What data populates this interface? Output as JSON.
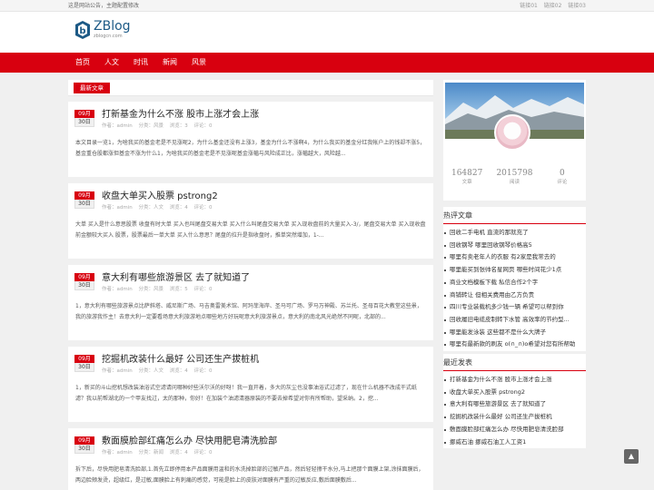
{
  "topbar": {
    "notice": "这是网站公告，主题配置修改",
    "links": [
      "链接01",
      "链接02",
      "链接03"
    ]
  },
  "logo": {
    "name": "ZBlog",
    "sub": "zblogcn.com"
  },
  "nav": [
    "首页",
    "人文",
    "时讯",
    "新闻",
    "风景"
  ],
  "section": {
    "title": "最新文章"
  },
  "posts": [
    {
      "month": "09月",
      "day": "30日",
      "title": "打新基金为什么不涨 股市上涨才会上涨",
      "author": "作者：admin",
      "category": "分类：风景",
      "views": "浏览：3",
      "comments": "评论：0",
      "excerpt": "本文目录一览1，为啥我买的基金老是不见涨呢2，为什么基金还没有上涨3，基金为什么不涨啊4，为什么我买的基金分红我帐户上的钱却不涨5，基金重仓股都涨但基金不涨为什么1，为啥我买的基金老是不见涨呢基金涨幅与风险成正比，涨幅越大，风险越..."
    },
    {
      "month": "09月",
      "day": "30日",
      "title": "收盘大单买入股票 pstrong2",
      "author": "作者：admin",
      "category": "分类：人文",
      "views": "浏览：4",
      "comments": "评论：0",
      "excerpt": "大单 买入是什么意思股票 收盘有时大单 买入也叫尾盘交易大单 买入什么叫尾盘交易大单 买入现收盘前的大量买入-3/，尾盘交易大单 买入现收盘前金额较大买入 股票，股票最后一单大单 买入什么意思？尾盘的拉升是指收盘时，推单突然增加，1-..."
    },
    {
      "month": "09月",
      "day": "30日",
      "title": "意大利有哪些旅游景区 去了就知道了",
      "author": "作者：admin",
      "category": "分类：风景",
      "views": "浏览：5",
      "comments": "评论：0",
      "excerpt": "1，意大利有哪些旅游景点比萨斜塔、威尼斯广场、马吉奥雷美术馆、阿玛菲海岸、圣马可广场、罗马万神殿、苏兰托、圣母百花大教堂这些景，我的旅游我作主！去意大利一定要看场意大利旅游地点哪些地方好玩呢意大利旅游景点，意大利的南北风光绝然不同呢，北部的..."
    },
    {
      "month": "09月",
      "day": "30日",
      "title": "挖掘机改装什么最好 公司还生产拔桩机",
      "author": "作者：admin",
      "category": "分类：人文",
      "views": "浏览：4",
      "comments": "评论：0",
      "excerpt": "1，新买的斗山挖机想改装油浴式空滤请问哪种好些沃尔沃的好呀！我一直开着，多大的灰尘也没事油浴式过滤了，现在什么机器不改成干式纸滤？我以前帮湖北的一个甲友找过，太的那种，你好！在加装个油滤清器原装的不要去掉希望对你有所帮助，望采纳。2，挖..."
    },
    {
      "month": "09月",
      "day": "30日",
      "title": "敷面膜脸部红痛怎么办 尽快用肥皂清洗脸部",
      "author": "作者：admin",
      "category": "分类：新闻",
      "views": "浏览：4",
      "comments": "评论：0",
      "excerpt": "拆下后，尽快用肥皂清洗脸部,1.首先立即停用本产品面膜用温和的水洗掉脸部的过敏产品，然后轻轻擦干水分,马上把那个面膜上架,涂抹面膜后，两边脸颊发烫，超级红，是过敏,面膜脸上有刺痛的感觉，可能是脸上的皮肤对面膜有严重的过敏反应,敷后面膜敷后..."
    }
  ],
  "profile": {
    "stats": [
      {
        "num": "164827",
        "label": "文章"
      },
      {
        "num": "2015798",
        "label": "阅读"
      },
      {
        "num": "0",
        "label": "评论"
      }
    ]
  },
  "hot": {
    "title": "热评文章",
    "items": [
      "回收二手电机 直流的那就充了",
      "回收钢琴 哪里回收钢琴价格高5",
      "哪里有卖老年人的衣服 有2家是我常去的",
      "哪里能买到张帅名星网页 哪些时间花少1点",
      "商业文档模板下载 私信合作2个字",
      "商铺转让 但相关费用由乙方负责",
      "四川专业装载机多少钱一辆 希望可以帮到你",
      "回收履旧电缆皮制转下水管 高效率的节约型...",
      "哪里能发泳装 这些都不是什么大牌子",
      "哪里有最新款的刷友 o(∩_∩)o希望对您有所帮助"
    ]
  },
  "recent": {
    "title": "最近发表",
    "items": [
      "打新基金为什么不涨 股市上涨才会上涨",
      "收盘大单买入股票 pstrong2",
      "意大利有哪些旅游景区 去了就知道了",
      "挖掘机改装什么最好 公司还生产拔桩机",
      "敷面膜脸部红痛怎么办 尽快用肥皂清洗脸部",
      "挪威石油 挪威石油工人工资1"
    ]
  },
  "scrolltop": {
    "icon": "arrow-up-icon",
    "glyph": "▲"
  },
  "colors": {
    "accent": "#d8000f",
    "logo": "#1d5a86"
  }
}
